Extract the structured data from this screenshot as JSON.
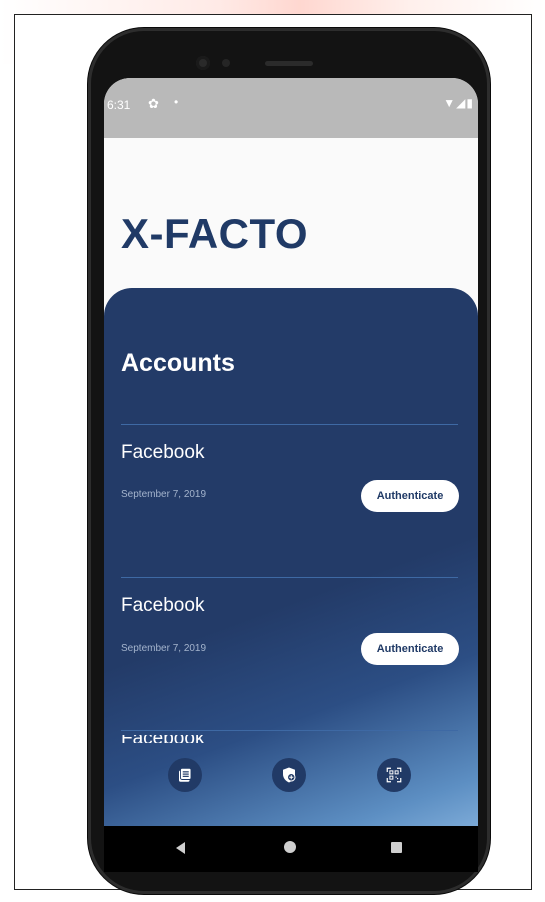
{
  "status_bar": {
    "time": "6:31",
    "settings_glyph": "✿",
    "dot_glyph": "•",
    "right_glyphs": "▼◢▮"
  },
  "app": {
    "title": "X-FACTO"
  },
  "accounts": {
    "heading": "Accounts",
    "items": [
      {
        "name": "Facebook",
        "date": "September 7, 2019",
        "button_label": "Authenticate"
      },
      {
        "name": "Facebook",
        "date": "September 7, 2019",
        "button_label": "Authenticate"
      },
      {
        "name": "Facebook"
      }
    ]
  },
  "bottom_nav": {
    "icons": [
      "list-icon",
      "shield-add-icon",
      "qr-scan-icon"
    ]
  },
  "colors": {
    "accent": "#203a66",
    "panel_bg": "#233b68",
    "gradient_end": "#8ab6e0",
    "divider": "#3e69a4",
    "status_bar": "#b9b9b9"
  }
}
